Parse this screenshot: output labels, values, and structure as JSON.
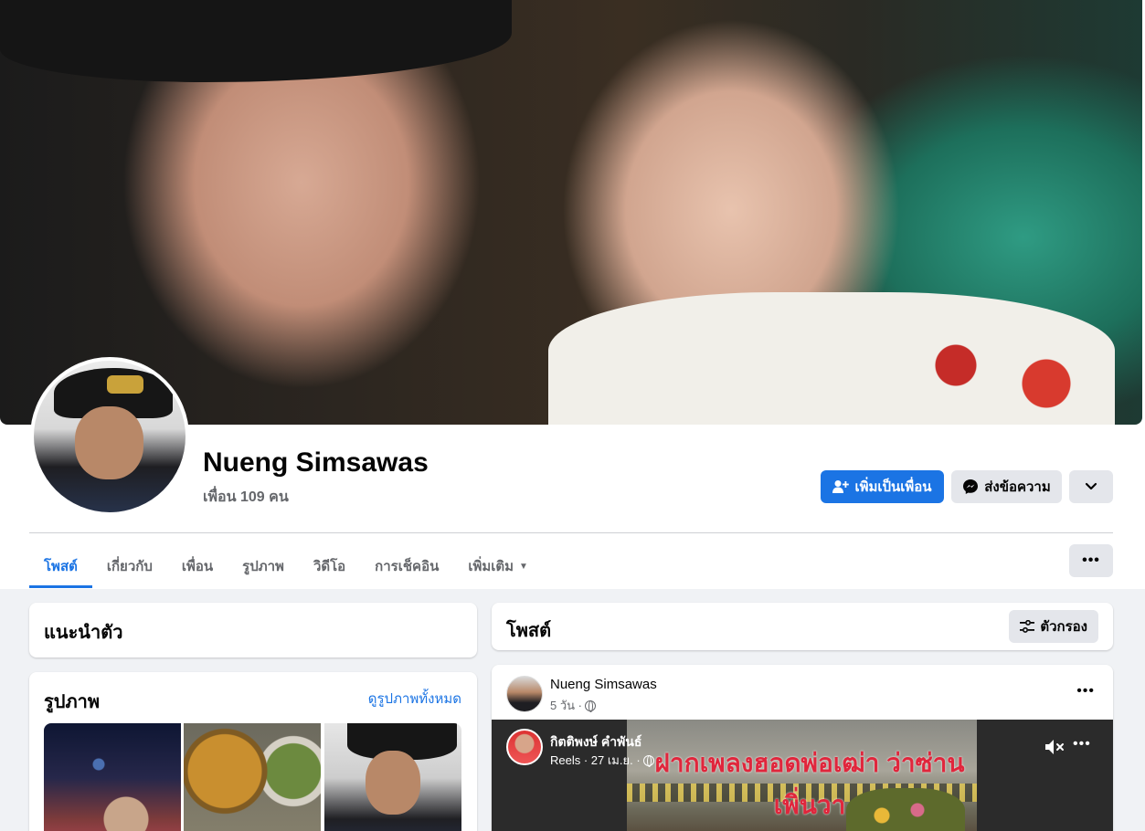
{
  "profile": {
    "name": "Nueng Simsawas",
    "friends": "เพื่อน 109 คน"
  },
  "actions": {
    "add_friend": "เพิ่มเป็นเพื่อน",
    "message": "ส่งข้อความ"
  },
  "tabs": [
    {
      "label": "โพสต์",
      "active": true
    },
    {
      "label": "เกี่ยวกับ"
    },
    {
      "label": "เพื่อน"
    },
    {
      "label": "รูปภาพ"
    },
    {
      "label": "วิดีโอ"
    },
    {
      "label": "การเช็คอิน"
    },
    {
      "label": "เพิ่มเติม"
    }
  ],
  "intro": {
    "title": "แนะนำตัว"
  },
  "photos": {
    "title": "รูปภาพ",
    "see_all": "ดูรูปภาพทั้งหมด"
  },
  "posts": {
    "title": "โพสต์",
    "filter": "ตัวกรอง",
    "items": [
      {
        "author": "Nueng Simsawas",
        "time": "5 วัน ·",
        "reel": {
          "author": "กิตติพงษ์ คำพันธ์",
          "meta": "Reels · 27 เม.ย. ·",
          "caption": "ฝากเพลงฮอดพ่อเฒ่า ว่าซ่านเพิ่นวา"
        }
      }
    ]
  },
  "colors": {
    "accent": "#1b74e4",
    "secondary_btn": "#e4e6eb",
    "page_bg": "#f0f2f5"
  },
  "icons": [
    "add-friend-icon",
    "messenger-icon",
    "chevron-down-icon",
    "more-icon",
    "filter-icon",
    "globe-icon",
    "mute-icon"
  ]
}
